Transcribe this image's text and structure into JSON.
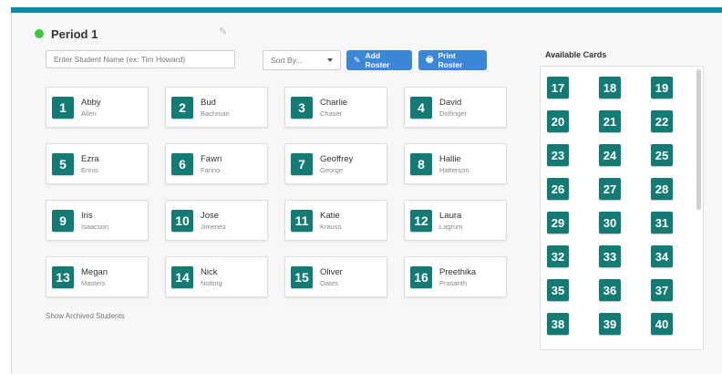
{
  "header": {
    "title": "Period 1",
    "status_color": "#41c441"
  },
  "toolbar": {
    "search_placeholder": "Enter Student Name (ex: Tim Howard)",
    "sort_label": "Sort By...",
    "add_roster_label": "Add Roster",
    "print_roster_label": "Print Roster"
  },
  "students": [
    {
      "card": "1",
      "first": "Abby",
      "last": "Allen"
    },
    {
      "card": "2",
      "first": "Bud",
      "last": "Bachman"
    },
    {
      "card": "3",
      "first": "Charlie",
      "last": "Chaser"
    },
    {
      "card": "4",
      "first": "David",
      "last": "Dolfinger"
    },
    {
      "card": "5",
      "first": "Ezra",
      "last": "Ennis"
    },
    {
      "card": "6",
      "first": "Fawn",
      "last": "Farino"
    },
    {
      "card": "7",
      "first": "Geoffrey",
      "last": "George"
    },
    {
      "card": "8",
      "first": "Hallie",
      "last": "Hatterson"
    },
    {
      "card": "9",
      "first": "Iris",
      "last": "Isaacson"
    },
    {
      "card": "10",
      "first": "Jose",
      "last": "Jimenez"
    },
    {
      "card": "11",
      "first": "Katie",
      "last": "Krauss"
    },
    {
      "card": "12",
      "first": "Laura",
      "last": "Lagrum"
    },
    {
      "card": "13",
      "first": "Megan",
      "last": "Masters"
    },
    {
      "card": "14",
      "first": "Nick",
      "last": "Notting"
    },
    {
      "card": "15",
      "first": "Oliver",
      "last": "Oates"
    },
    {
      "card": "16",
      "first": "Preethika",
      "last": "Prasanth"
    }
  ],
  "footer": {
    "archived_link": "Show Archived Students"
  },
  "available": {
    "title": "Available Cards",
    "cards": [
      "17",
      "18",
      "19",
      "20",
      "21",
      "22",
      "23",
      "24",
      "25",
      "26",
      "27",
      "28",
      "29",
      "30",
      "31",
      "32",
      "33",
      "34",
      "35",
      "36",
      "37",
      "38",
      "39",
      "40"
    ]
  },
  "colors": {
    "accent": "#3b86d6",
    "card": "#137b73",
    "topbar": "#0f8aa6"
  }
}
